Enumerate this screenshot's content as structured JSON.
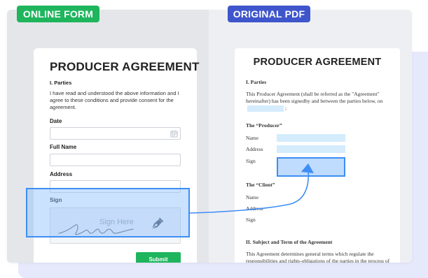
{
  "badges": {
    "online_form": "ONLINE FORM",
    "original_pdf": "ORIGINAL PDF"
  },
  "form": {
    "title": "PRODUCER AGREEMENT",
    "section": "I. Parties",
    "consent": "I have read and understood the above information and I agree to these conditions and provide consent for the agreement.",
    "date_label": "Date",
    "fullname_label": "Full Name",
    "address_label": "Address",
    "sign_label": "Sign",
    "sign_placeholder": "Sign Here",
    "submit_label": "Submit"
  },
  "pdf": {
    "title": "PRODUCER AGREEMENT",
    "section1": "I. Parties",
    "intro": "This Producer Agreement (shall be referred as the \"Agreement\" hereinafter) has been signedby and between the parties below, on",
    "intro_end": ";",
    "producer_heading": "The “Producer”",
    "client_heading": "The “Client”",
    "name_label": "Name",
    "address_label": "Address",
    "sign_label": "Sign",
    "section2": "II.  Subject and Term of the Agreement",
    "section2_text": "This Agreement determines general terms which regulate the responsibilities and rights-obligations of the parties in the process of production of video"
  },
  "colors": {
    "green": "#1eb55d",
    "blue": "#3e55cc",
    "highlight_border": "#3d8ef5",
    "pdf_fill": "#d4ecfc"
  },
  "icons": [
    "calendar-icon",
    "pen-nib-icon",
    "arrow-connector"
  ]
}
